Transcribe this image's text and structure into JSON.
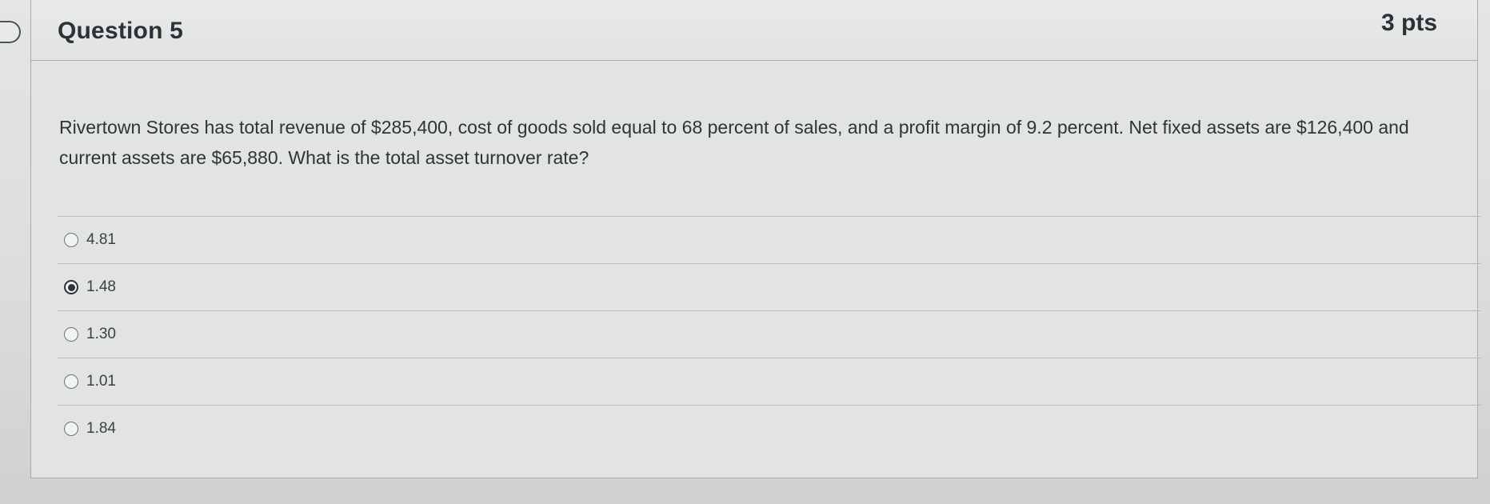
{
  "question": {
    "title": "Question 5",
    "points": "3 pts",
    "text": "Rivertown Stores has total revenue of $285,400, cost of goods sold equal to 68 percent of sales, and a profit margin of 9.2 percent. Net fixed assets are $126,400 and current assets are $65,880. What is the total asset turnover rate?"
  },
  "answers": [
    {
      "label": "4.81",
      "selected": false
    },
    {
      "label": "1.48",
      "selected": true
    },
    {
      "label": "1.30",
      "selected": false
    },
    {
      "label": "1.01",
      "selected": false
    },
    {
      "label": "1.84",
      "selected": false
    }
  ]
}
